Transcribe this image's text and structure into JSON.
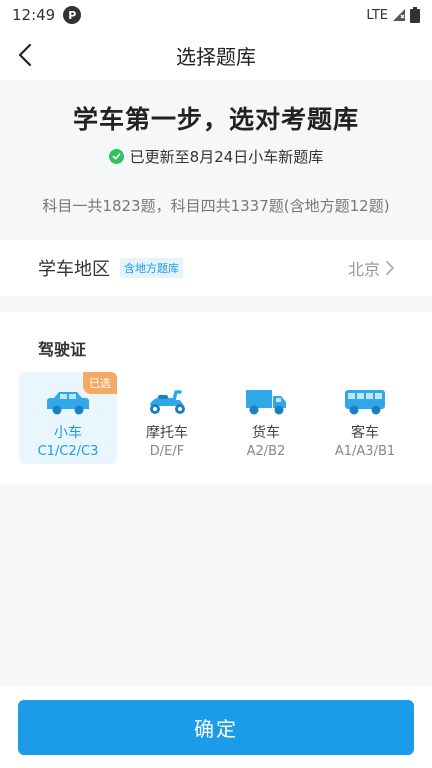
{
  "status_bar": {
    "time": "12:49",
    "app_icon_glyph": "P",
    "network": "LTE"
  },
  "header": {
    "title": "选择题库"
  },
  "intro": {
    "headline": "学车第一步，选对考题库",
    "update_text": "已更新至8月24日小车新题库",
    "summary": "科目一共1823题，科目四共1337题(含地方题12题)"
  },
  "region": {
    "label": "学车地区",
    "tag": "含地方题库",
    "value": "北京"
  },
  "license": {
    "title": "驾驶证",
    "selected_badge": "已选",
    "vehicles": [
      {
        "name": "小车",
        "sub": "C1/C2/C3",
        "icon": "car-icon",
        "selected": true
      },
      {
        "name": "摩托车",
        "sub": "D/E/F",
        "icon": "scooter-icon",
        "selected": false
      },
      {
        "name": "货车",
        "sub": "A2/B2",
        "icon": "truck-icon",
        "selected": false
      },
      {
        "name": "客车",
        "sub": "A1/A3/B1",
        "icon": "bus-icon",
        "selected": false
      }
    ]
  },
  "footer": {
    "confirm_label": "确定"
  },
  "colors": {
    "accent": "#1c9ce8",
    "badge": "#f7a864",
    "check": "#2fc25b",
    "selected_bg": "#eaf6fd"
  }
}
